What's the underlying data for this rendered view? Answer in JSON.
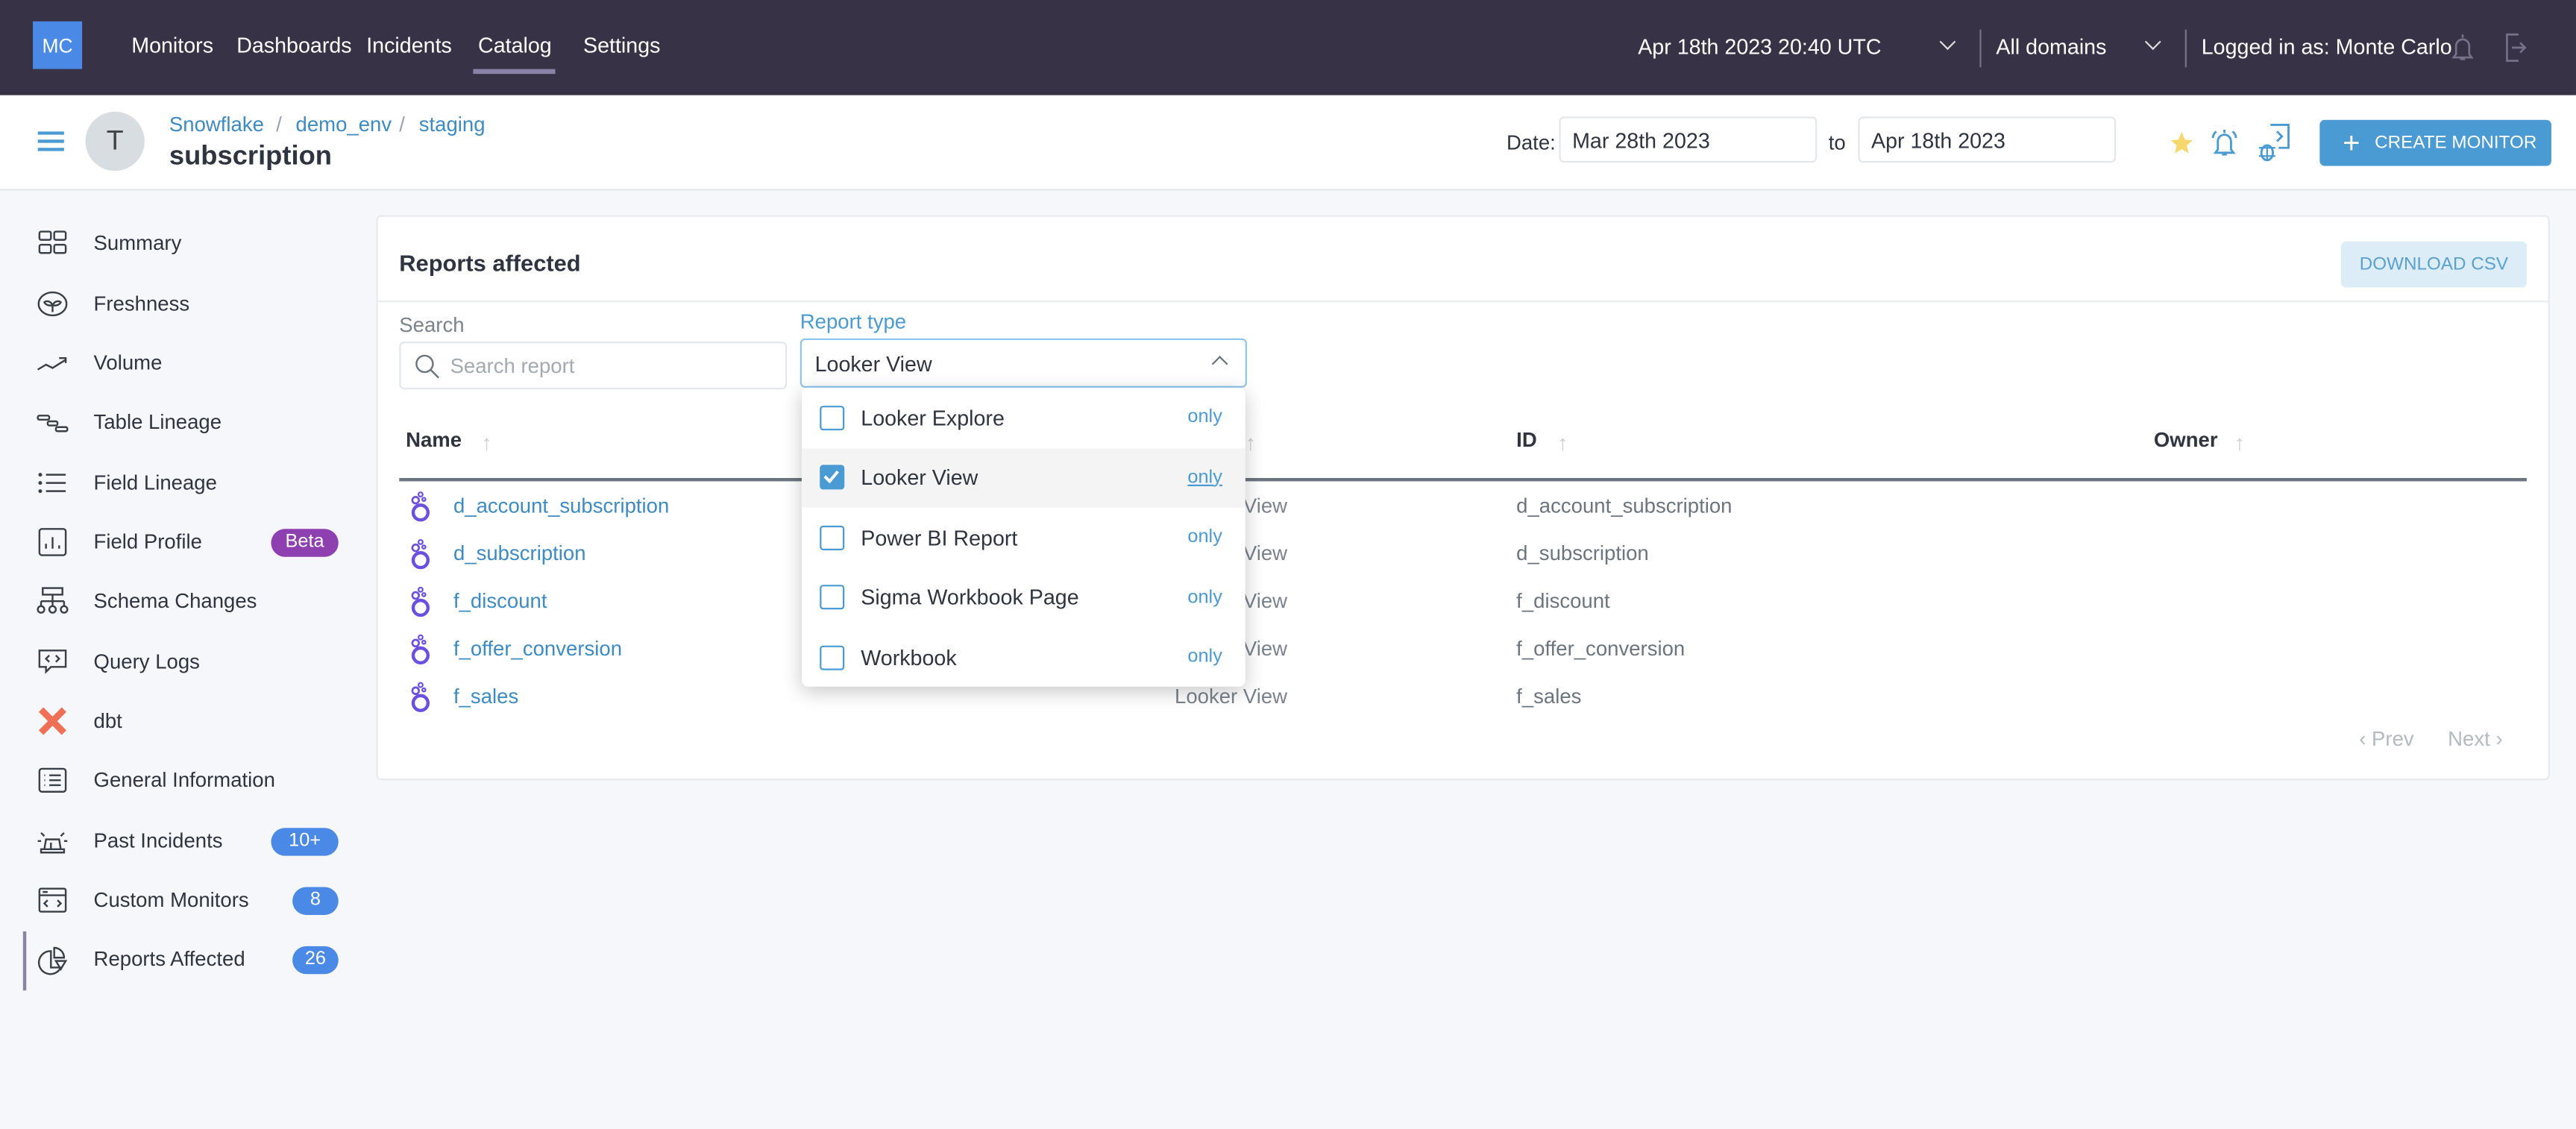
{
  "topbar": {
    "logo": "MC",
    "nav": [
      "Monitors",
      "Dashboards",
      "Incidents",
      "Catalog",
      "Settings"
    ],
    "active_nav": "Catalog",
    "datetime": "Apr 18th 2023 20:40 UTC",
    "domain": "All domains",
    "logged_in": "Logged in as: Monte Carlo"
  },
  "header": {
    "avatar_letter": "T",
    "breadcrumb": [
      "Snowflake",
      "demo_env",
      "staging"
    ],
    "title": "subscription",
    "date_label": "Date:",
    "date_from": "Mar 28th 2023",
    "to_label": "to",
    "date_to": "Apr 18th 2023",
    "create_label": "CREATE MONITOR"
  },
  "sidebar": {
    "items": [
      {
        "label": "Summary",
        "icon": "grid-icon"
      },
      {
        "label": "Freshness",
        "icon": "sprout-icon"
      },
      {
        "label": "Volume",
        "icon": "trend-icon"
      },
      {
        "label": "Table Lineage",
        "icon": "lineage-icon"
      },
      {
        "label": "Field Lineage",
        "icon": "list-icon"
      },
      {
        "label": "Field Profile",
        "icon": "bar-chart-icon",
        "badge": "Beta",
        "badge_color": "#8e3fb0"
      },
      {
        "label": "Schema Changes",
        "icon": "hierarchy-icon"
      },
      {
        "label": "Query Logs",
        "icon": "code-bubble-icon"
      },
      {
        "label": "dbt",
        "icon": "dbt-icon"
      },
      {
        "label": "General Information",
        "icon": "info-list-icon"
      },
      {
        "label": "Past Incidents",
        "icon": "siren-icon",
        "badge": "10+",
        "badge_color": "#4a8ae6"
      },
      {
        "label": "Custom Monitors",
        "icon": "code-window-icon",
        "badge": "8",
        "badge_color": "#4a8ae6"
      },
      {
        "label": "Reports Affected",
        "icon": "pie-icon",
        "badge": "26",
        "badge_color": "#4a8ae6"
      }
    ],
    "active": "Reports Affected"
  },
  "card": {
    "title": "Reports affected",
    "download_label": "DOWNLOAD CSV",
    "search_label": "Search",
    "search_placeholder": "Search report",
    "type_label": "Report type",
    "type_value": "Looker View",
    "columns": {
      "name": "Name",
      "id": "ID",
      "owner": "Owner"
    },
    "rows": [
      {
        "name": "d_account_subscription",
        "type": "Looker View",
        "id": "d_account_subscription",
        "owner": ""
      },
      {
        "name": "d_subscription",
        "type": "Looker View",
        "id": "d_subscription",
        "owner": ""
      },
      {
        "name": "f_discount",
        "type": "Looker View",
        "id": "f_discount",
        "owner": ""
      },
      {
        "name": "f_offer_conversion",
        "type": "Looker View",
        "id": "f_offer_conversion",
        "owner": ""
      },
      {
        "name": "f_sales",
        "type": "Looker View",
        "id": "f_sales",
        "owner": ""
      }
    ],
    "prev": "Prev",
    "next": "Next"
  },
  "dropdown": {
    "only_label": "only",
    "options": [
      {
        "label": "Looker Explore",
        "checked": false
      },
      {
        "label": "Looker View",
        "checked": true
      },
      {
        "label": "Power BI Report",
        "checked": false
      },
      {
        "label": "Sigma Workbook Page",
        "checked": false
      },
      {
        "label": "Workbook",
        "checked": false
      }
    ]
  },
  "colors": {
    "topbar": "#373246",
    "accent": "#4a9ad4",
    "link": "#3d8bc4",
    "looker": "#6b4fe0"
  }
}
